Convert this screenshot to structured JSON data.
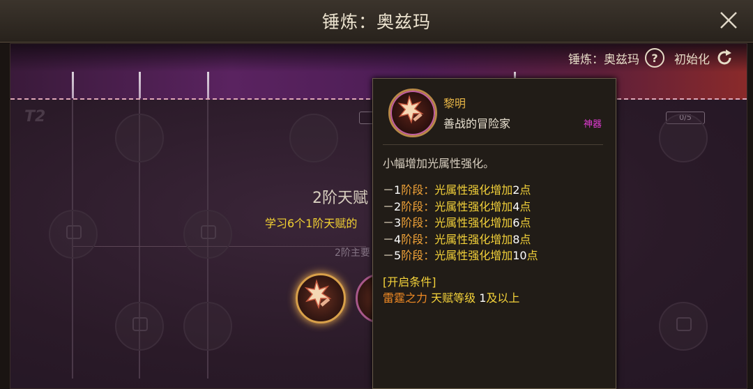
{
  "window": {
    "title": "锤炼：奥兹玛"
  },
  "controls": {
    "label": "锤炼：奥兹玛",
    "help_glyph": "?",
    "reset_label": "初始化"
  },
  "tier": {
    "title": "2阶天赋",
    "requirement": "学习6个1阶天赋的",
    "main": "2阶主要",
    "badges": [
      "0/5",
      "0/5",
      "0/5"
    ]
  },
  "tooltip": {
    "name": "黎明",
    "subtitle": "善战的冒险家",
    "rarity": "神器",
    "rarity_color": "#e23bd4",
    "description": "小幅增加光属性强化。",
    "stages": [
      {
        "dash": "－",
        "num": "1",
        "label": "阶段：",
        "text": "光属性强化增加",
        "value": "2",
        "unit": "点"
      },
      {
        "dash": "－",
        "num": "2",
        "label": "阶段：",
        "text": "光属性强化增加",
        "value": "4",
        "unit": "点"
      },
      {
        "dash": "－",
        "num": "3",
        "label": "阶段：",
        "text": "光属性强化增加",
        "value": "6",
        "unit": "点"
      },
      {
        "dash": "－",
        "num": "4",
        "label": "阶段：",
        "text": "光属性强化增加",
        "value": "8",
        "unit": "点"
      },
      {
        "dash": "－",
        "num": "5",
        "label": "阶段：",
        "text": "光属性强化增加",
        "value": "10",
        "unit": "点"
      }
    ],
    "condition_title": "[开启条件]",
    "condition": {
      "skill": "雷霆之力",
      "text": "天赋等级",
      "level": "1",
      "suffix": "及以上"
    }
  },
  "icons": {
    "close": "close-icon",
    "help": "question-icon",
    "refresh": "refresh-icon",
    "skill": "star-sword-icon"
  }
}
